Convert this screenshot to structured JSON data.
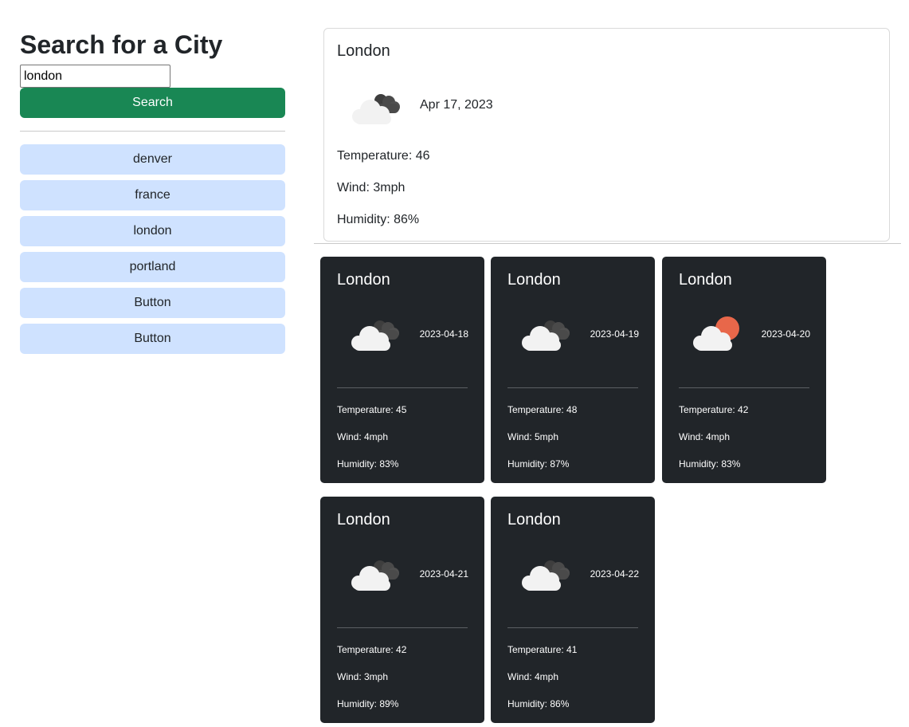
{
  "search": {
    "title": "Search for a City",
    "input_value": "london",
    "button_label": "Search"
  },
  "history": [
    "denver",
    "france",
    "london",
    "portland",
    "Button",
    "Button"
  ],
  "current": {
    "city": "London",
    "date": "Apr 17, 2023",
    "icon": "cloudy-icon",
    "temperature": "Temperature: 46",
    "wind": "Wind: 3mph",
    "humidity": "Humidity: 86%"
  },
  "forecast": [
    {
      "city": "London",
      "date": "2023-04-18",
      "icon": "cloudy-icon",
      "temperature": "Temperature: 45",
      "wind": "Wind: 4mph",
      "humidity": "Humidity: 83%"
    },
    {
      "city": "London",
      "date": "2023-04-19",
      "icon": "cloudy-icon",
      "temperature": "Temperature: 48",
      "wind": "Wind: 5mph",
      "humidity": "Humidity: 87%"
    },
    {
      "city": "London",
      "date": "2023-04-20",
      "icon": "partly-cloudy-icon",
      "temperature": "Temperature: 42",
      "wind": "Wind: 4mph",
      "humidity": "Humidity: 83%"
    },
    {
      "city": "London",
      "date": "2023-04-21",
      "icon": "cloudy-icon",
      "temperature": "Temperature: 42",
      "wind": "Wind: 3mph",
      "humidity": "Humidity: 89%"
    },
    {
      "city": "London",
      "date": "2023-04-22",
      "icon": "cloudy-icon",
      "temperature": "Temperature: 41",
      "wind": "Wind: 4mph",
      "humidity": "Humidity: 86%"
    }
  ],
  "colors": {
    "search_button": "#198754",
    "history_button": "#cfe2ff",
    "forecast_card": "#212529",
    "sun": "#e8674a"
  }
}
